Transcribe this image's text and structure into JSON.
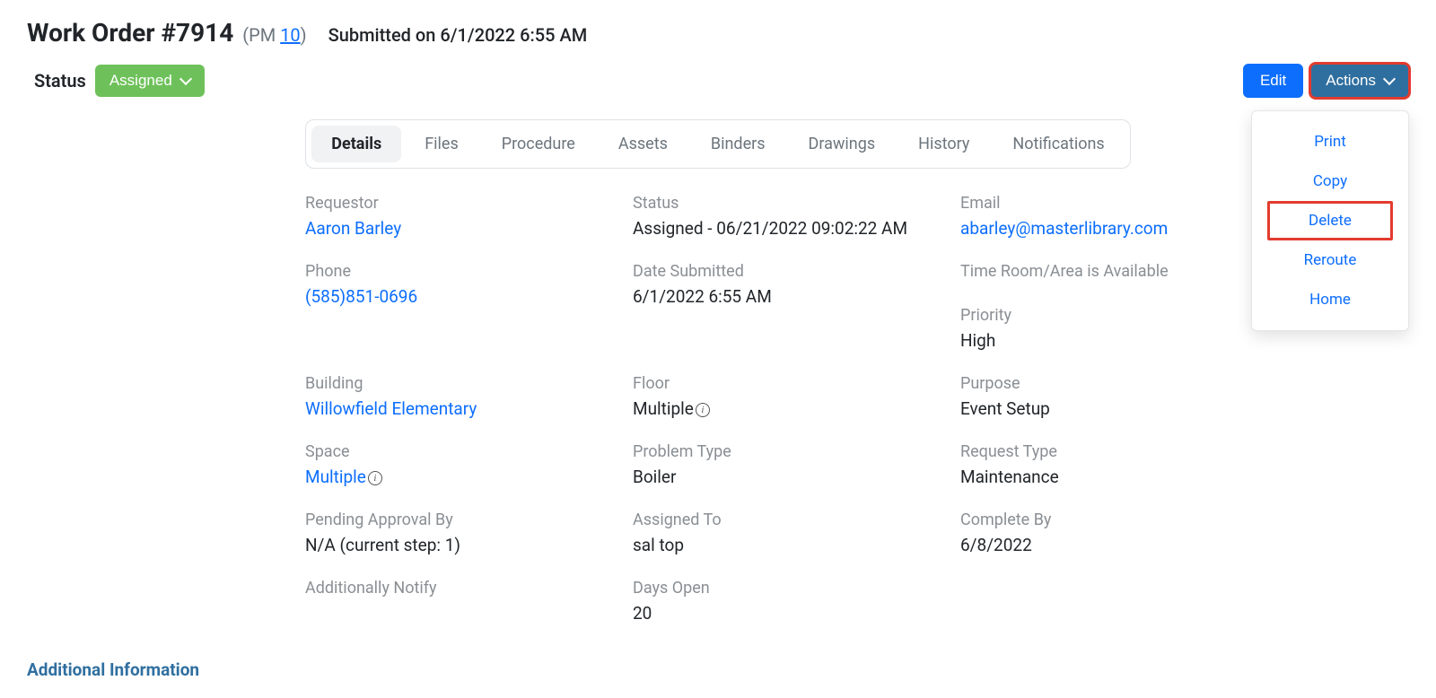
{
  "header": {
    "title": "Work Order #7914",
    "pm_prefix": "(PM ",
    "pm_link": "10",
    "pm_suffix": ")",
    "submitted": "Submitted on 6/1/2022 6:55 AM"
  },
  "status": {
    "label": "Status",
    "badge": "Assigned"
  },
  "buttons": {
    "edit": "Edit",
    "actions": "Actions"
  },
  "actions_menu": {
    "print": "Print",
    "copy": "Copy",
    "delete": "Delete",
    "reroute": "Reroute",
    "home": "Home"
  },
  "tabs": {
    "details": "Details",
    "files": "Files",
    "procedure": "Procedure",
    "assets": "Assets",
    "binders": "Binders",
    "drawings": "Drawings",
    "history": "History",
    "notifications": "Notifications"
  },
  "fields": {
    "requestor": {
      "label": "Requestor",
      "value": "Aaron Barley"
    },
    "status": {
      "label": "Status",
      "value": "Assigned - 06/21/2022 09:02:22 AM"
    },
    "email": {
      "label": "Email",
      "value": "abarley@masterlibrary.com"
    },
    "phone": {
      "label": "Phone",
      "value": "(585)851-0696"
    },
    "date_submitted": {
      "label": "Date Submitted",
      "value": "6/1/2022 6:55 AM"
    },
    "time_room": {
      "label": "Time Room/Area is Available",
      "value": ""
    },
    "priority": {
      "label": "Priority",
      "value": "High"
    },
    "building": {
      "label": "Building",
      "value": "Willowfield Elementary"
    },
    "floor": {
      "label": "Floor",
      "value": "Multiple"
    },
    "purpose": {
      "label": "Purpose",
      "value": "Event Setup"
    },
    "space": {
      "label": "Space",
      "value": "Multiple"
    },
    "problem_type": {
      "label": "Problem Type",
      "value": "Boiler"
    },
    "request_type": {
      "label": "Request Type",
      "value": "Maintenance"
    },
    "pending_approval": {
      "label": "Pending Approval By",
      "value": "N/A (current step: 1)"
    },
    "assigned_to": {
      "label": "Assigned To",
      "value": "sal top"
    },
    "complete_by": {
      "label": "Complete By",
      "value": "6/8/2022"
    },
    "additionally_notify": {
      "label": "Additionally Notify",
      "value": ""
    },
    "days_open": {
      "label": "Days Open",
      "value": "20"
    }
  },
  "section": {
    "additional_info": "Additional Information"
  }
}
